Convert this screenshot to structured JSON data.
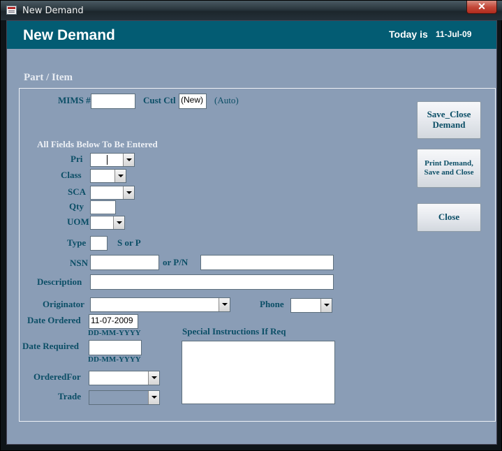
{
  "window": {
    "title": "New Demand",
    "close_glyph": "✕"
  },
  "header": {
    "title": "New Demand",
    "today_label": "Today is",
    "today_date": "11-Jul-09"
  },
  "section": {
    "title": "Part / Item"
  },
  "fields": {
    "mims_label": "MIMS #",
    "mims_value": "",
    "custctl_label": "Cust Ctl",
    "custctl_value": "(New)",
    "custctl_hint": "(Auto)",
    "all_below_label": "All Fields Below To Be Entered",
    "pri_label": "Pri",
    "class_label": "Class",
    "sca_label": "SCA",
    "qty_label": "Qty",
    "uom_label": "UOM",
    "type_label": "Type",
    "type_hint": "S or P",
    "nsn_label": "NSN",
    "or_pn_label": "or  P/N",
    "description_label": "Description",
    "originator_label": "Originator",
    "phone_label": "Phone",
    "date_ordered_label": "Date Ordered",
    "date_ordered_value": "11-07-2009",
    "date_ordered_format": "DD-MM-YYYY",
    "date_required_label": "Date Required",
    "date_required_format": "DD-MM-YYYY",
    "special_instructions_label": "Special Instructions If Req",
    "ordered_for_label": "OrderedFor",
    "trade_label": "Trade"
  },
  "buttons": {
    "save_close_line1": "Save_Close",
    "save_close_line2": "Demand",
    "print_line1": "Print Demand,",
    "print_line2": "Save and Close",
    "close": "Close"
  },
  "colors": {
    "header": "#035c73",
    "form_bg": "#8a9db6",
    "label": "#0b4e66"
  }
}
